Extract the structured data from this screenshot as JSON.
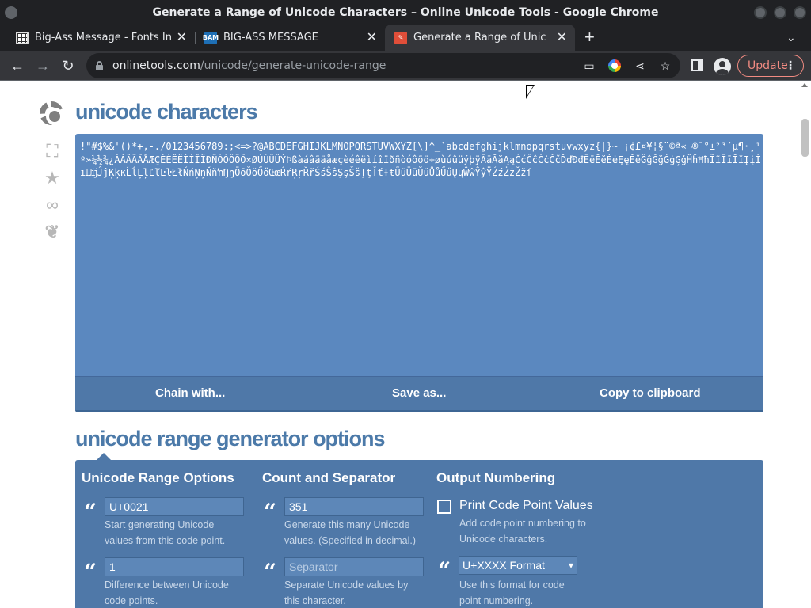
{
  "window": {
    "title": "Generate a Range of Unicode Characters – Online Unicode Tools - Google Chrome"
  },
  "tabs": [
    {
      "label": "Big-Ass Message - Fonts In Use",
      "favicon": "grid-favicon-icon",
      "active": false
    },
    {
      "label": "BIG-ASS MESSAGE",
      "favicon": "bam-favicon-icon",
      "favicon_text": "BAM",
      "active": false
    },
    {
      "label": "Generate a Range of Unicode Characters",
      "favicon": "wrench-favicon-icon",
      "active": true
    }
  ],
  "toolbar": {
    "url_host": "onlinetools.com",
    "url_path": "/unicode/generate-unicode-range",
    "update_label": "Update"
  },
  "page": {
    "output_heading": "unicode characters",
    "output_text": "!\"#$%&'()*+,-./0123456789:;<=>?@ABCDEFGHIJKLMNOPQRSTUVWXYZ[\\]^_`abcdefghijklmnopqrstuvwxyz{|}~ ¡¢£¤¥¦§¨©ª«¬­®¯°±²³´µ¶·¸¹º»¼½¾¿ÀÁÂÃÄÅÆÇÈÉÊËÌÍÎÏÐÑÒÓÔÕÖ×ØÙÚÛÜÝÞßàáâãäåæçèéêëìíîïðñòóôõö÷øùúûüýþÿĀāĂăĄąĆćĈĉĊċČčĎďĐđĒēĔĕĖėĘęĚěĜĝĞğĠġĢģĤĥĦħĨĩĪīĬĭĮįİıĲĳĴĵĶķĸĹĺĻļĽľĿŀŁłŃńŅņŇňŉŊŋŌōŎŏŐőŒœŔŕŖŗŘřŚśŜŝŞşŠšŢţŤťŦŧŨũŪūŬŭŮůŰűŲųŴŵŶŷŸŹźŻżŽžſ",
    "actions": {
      "chain": "Chain with...",
      "save": "Save as...",
      "copy": "Copy to clipboard"
    },
    "options_heading": "unicode range generator options",
    "options": {
      "range": {
        "title": "Unicode Range Options",
        "start_value": "U+0021",
        "start_hint": "Start generating Unicode values from this code point.",
        "step_value": "1",
        "step_hint": "Difference between Unicode code points."
      },
      "count": {
        "title": "Count and Separator",
        "count_value": "351",
        "count_hint": "Generate this many Unicode values. (Specified in decimal.)",
        "separator_placeholder": "Separator",
        "separator_hint": "Separate Unicode values by this character."
      },
      "numbering": {
        "title": "Output Numbering",
        "checkbox_label": "Print Code Point Values",
        "checkbox_checked": false,
        "checkbox_hint": "Add code point numbering to Unicode characters.",
        "format_selected": "U+XXXX Format",
        "format_hint": "Use this format for code point numbering."
      }
    }
  },
  "colors": {
    "accent": "#4c7aa9",
    "panel": "#5b88bf",
    "options_panel": "#4f78a8"
  }
}
